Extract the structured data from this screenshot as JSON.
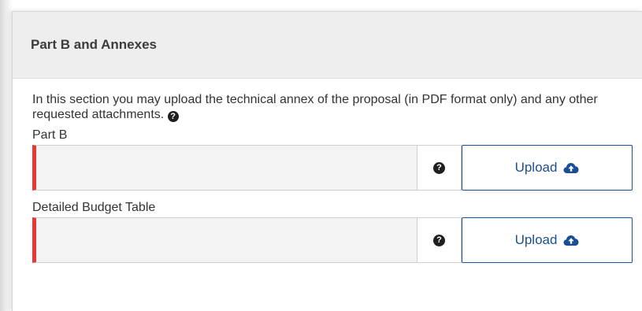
{
  "panel": {
    "title": "Part B and Annexes",
    "intro": "In this section you may upload the technical annex of the proposal (in PDF format only) and any other requested attachments."
  },
  "fields": [
    {
      "label": "Part B",
      "help_glyph": "?",
      "upload_label": "Upload"
    },
    {
      "label": "Detailed Budget Table",
      "help_glyph": "?",
      "upload_label": "Upload"
    }
  ],
  "icons": {
    "help": "question-circle-icon",
    "upload": "cloud-upload-icon"
  },
  "colors": {
    "required_marker": "#e53935",
    "upload_button": "#1b4f93",
    "header_background": "#eeeeee",
    "file_box_background": "#f3f3f3"
  }
}
